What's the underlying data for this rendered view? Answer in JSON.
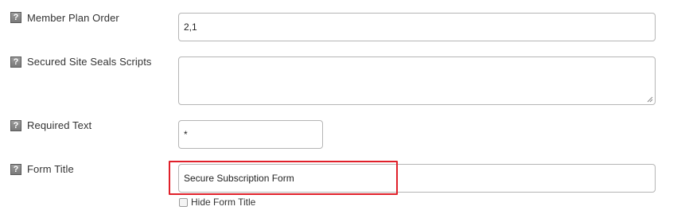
{
  "fields": {
    "member_plan_order": {
      "label": "Member Plan Order",
      "value": "2,1"
    },
    "secured_site_seals": {
      "label": "Secured Site Seals Scripts",
      "value": ""
    },
    "required_text": {
      "label": "Required Text",
      "value": "*"
    },
    "form_title": {
      "label": "Form Title",
      "value": "Secure Subscription Form"
    }
  },
  "hide_form_title": {
    "label": "Hide Form Title",
    "checked": false
  },
  "help_icon_glyph": "?",
  "colors": {
    "highlight": "#e0202a",
    "help_icon": "#808080",
    "field_border": "#b5b5b5"
  }
}
